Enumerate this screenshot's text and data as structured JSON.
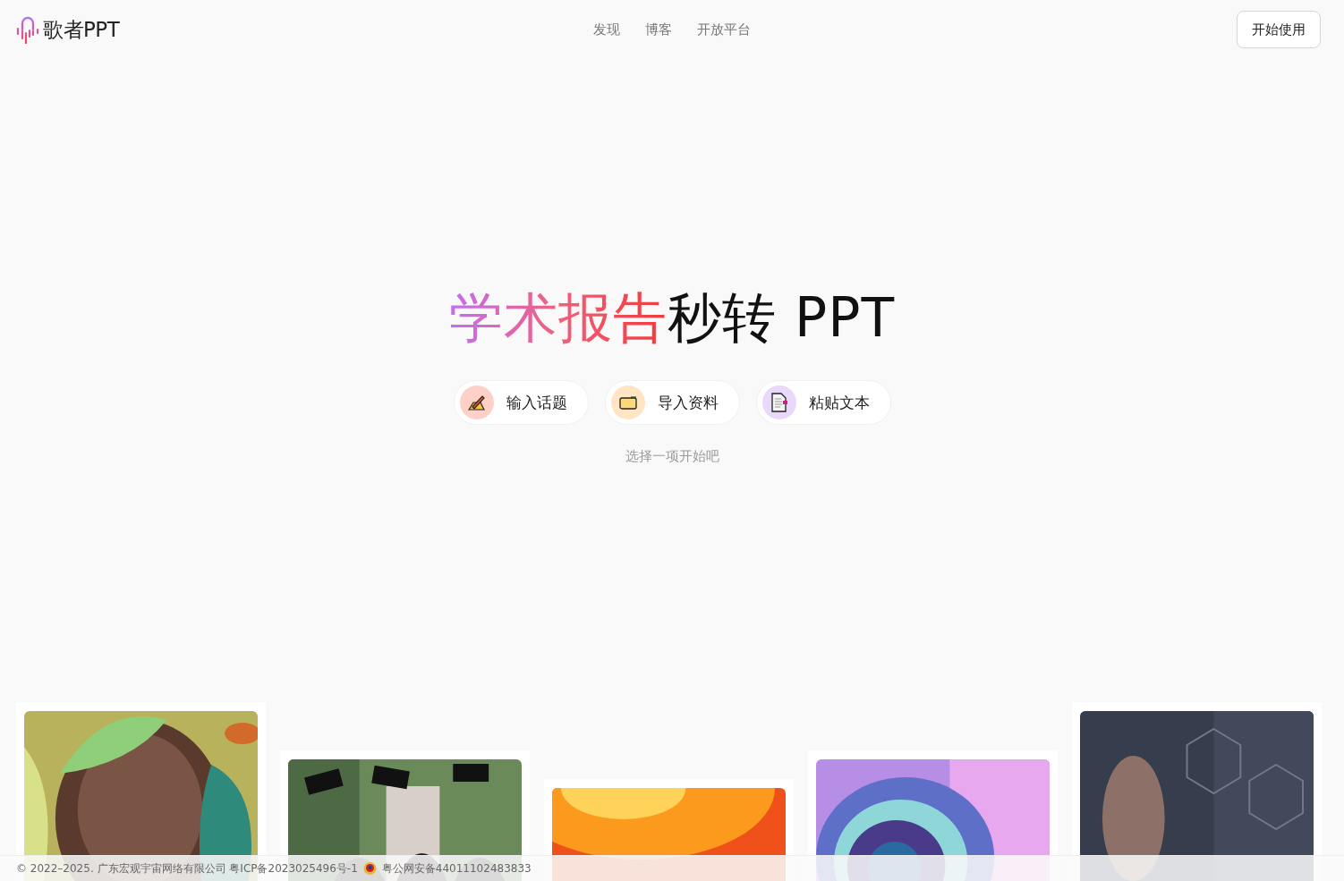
{
  "header": {
    "logo_text": "歌者PPT",
    "nav": [
      {
        "label": "发现"
      },
      {
        "label": "博客"
      },
      {
        "label": "开放平台"
      }
    ],
    "cta": "开始使用"
  },
  "hero": {
    "title_highlight": "学术报告",
    "title_rest": "秒转 PPT",
    "options": [
      {
        "kind": "topic",
        "label": "输入话题"
      },
      {
        "kind": "import",
        "label": "导入资料"
      },
      {
        "kind": "paste",
        "label": "粘贴文本"
      }
    ],
    "hint": "选择一项开始吧"
  },
  "footer": {
    "copyright": "© 2022–2025. 广东宏观宇宙网络有限公司 粤ICP备2023025496号-1",
    "police_record": "粤公网安备44011102483833"
  }
}
